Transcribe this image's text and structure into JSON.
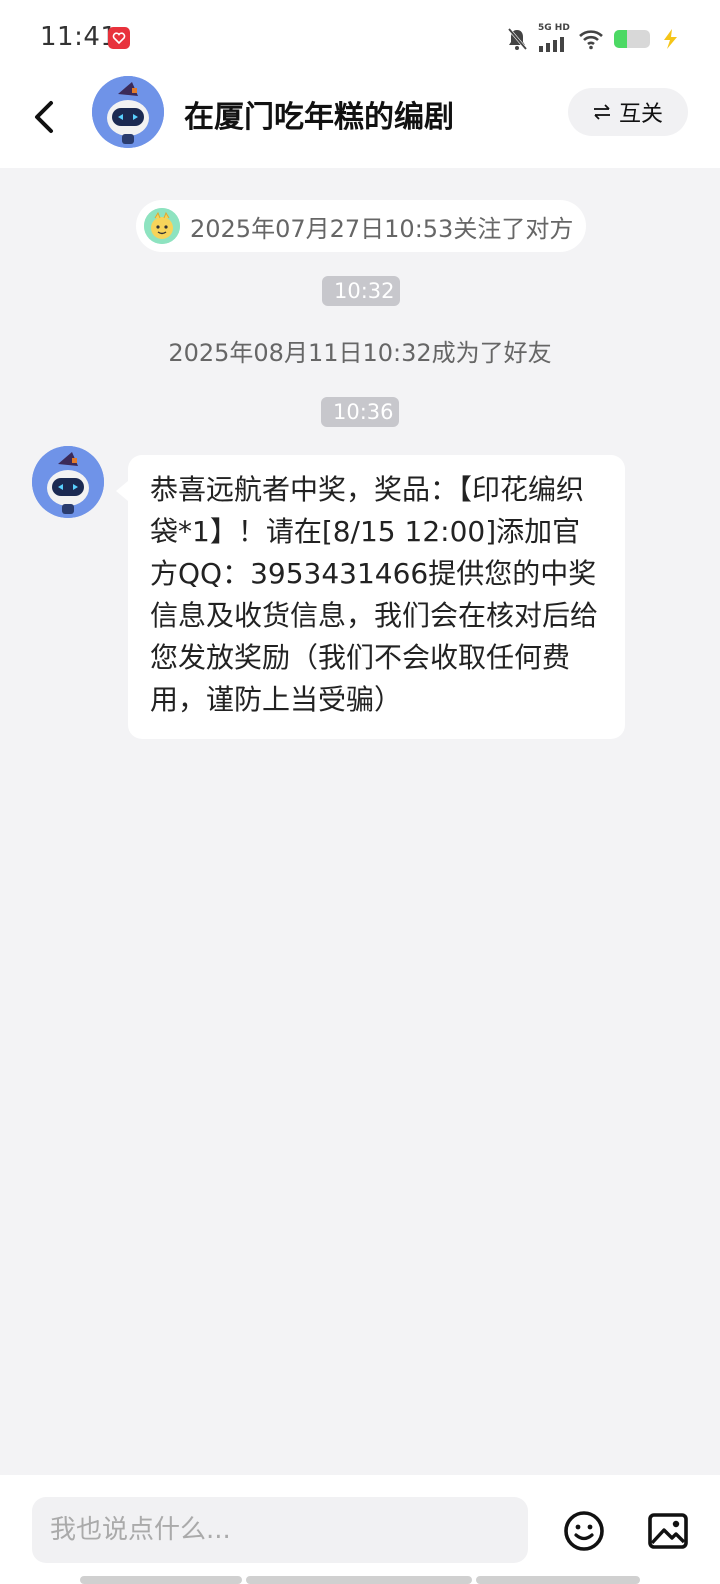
{
  "status_bar": {
    "time": "11:41",
    "network_label": "5G HD",
    "icons": [
      "app-badge-icon",
      "mute-icon",
      "signal-icon",
      "wifi-icon",
      "battery-icon",
      "charging-icon"
    ],
    "battery_level": 0.35
  },
  "header": {
    "title": "在厦门吃年糕的编剧",
    "follow_button": "互关",
    "back_icon": "back-arrow-icon",
    "swap_icon": "swap-arrows-icon"
  },
  "chat": {
    "follow_notice": "2025年07月27日10:53关注了对方",
    "time_1": "10:32",
    "friend_notice": "2025年08月11日10:32成为了好友",
    "time_2": "10:36",
    "message": "恭喜远航者中奖，奖品：【印花编织袋*1】！请在[8/15 12:00]添加官方QQ：3953431466提供您的中奖信息及收货信息，我们会在核对后给您发放奖励（我们不会收取任何费用，谨防上当受骗）"
  },
  "input_bar": {
    "placeholder": "我也说点什么...",
    "emoji_icon": "emoji-icon",
    "image_icon": "image-icon"
  },
  "colors": {
    "background": "#f3f3f5",
    "bubble": "#ffffff",
    "time_chip": "#c7c7cc",
    "avatar": "#6f93e8",
    "battery": "#4cd964"
  }
}
